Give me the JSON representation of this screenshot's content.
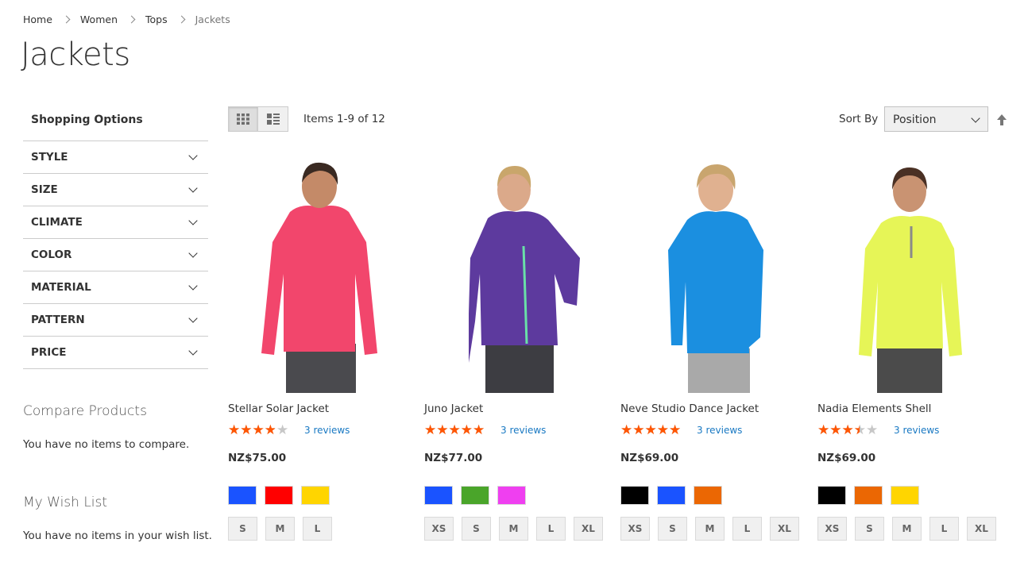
{
  "breadcrumb": [
    "Home",
    "Women",
    "Tops",
    "Jackets"
  ],
  "page_title": "Jackets",
  "sidebar": {
    "title": "Shopping Options",
    "filters": [
      "STYLE",
      "SIZE",
      "CLIMATE",
      "COLOR",
      "MATERIAL",
      "PATTERN",
      "PRICE"
    ]
  },
  "compare": {
    "title": "Compare Products",
    "text": "You have no items to compare."
  },
  "wishlist": {
    "title": "My Wish List",
    "text": "You have no items in your wish list."
  },
  "toolbar": {
    "modes": [
      "grid-icon",
      "list-icon"
    ],
    "active_mode": "grid",
    "items_count": "Items 1-9 of 12",
    "sort_label": "Sort By",
    "sort_value": "Position"
  },
  "colors": {
    "star": "#ff5501",
    "link": "#1979c3"
  },
  "products": [
    {
      "name": "Stellar Solar Jacket",
      "rating": 0.67,
      "reviews": "3 reviews",
      "price": "NZ$75.00",
      "jacket_color": "#f2466c",
      "pants_color": "#4a4a4e",
      "swatches": [
        "#1a53ff",
        "#ff0000",
        "#ffd500"
      ],
      "sizes": [
        "S",
        "M",
        "L"
      ]
    },
    {
      "name": "Juno Jacket",
      "rating": 0.87,
      "reviews": "3 reviews",
      "price": "NZ$77.00",
      "jacket_color": "#5d3a9e",
      "pants_color": "#3d3d42",
      "swatches": [
        "#1a53ff",
        "#4aa52a",
        "#ef3ff0"
      ],
      "sizes": [
        "XS",
        "S",
        "M",
        "L",
        "XL"
      ]
    },
    {
      "name": "Neve Studio Dance Jacket",
      "rating": 0.87,
      "reviews": "3 reviews",
      "price": "NZ$69.00",
      "jacket_color": "#1b8fe0",
      "pants_color": "#a9a9a9",
      "swatches": [
        "#000000",
        "#1a53ff",
        "#eb6703"
      ],
      "sizes": [
        "XS",
        "S",
        "M",
        "L",
        "XL"
      ]
    },
    {
      "name": "Nadia Elements Shell",
      "rating": 0.6,
      "reviews": "3 reviews",
      "price": "NZ$69.00",
      "jacket_color": "#e6f557",
      "pants_color": "#4b4b4b",
      "swatches": [
        "#000000",
        "#eb6703",
        "#ffd500"
      ],
      "sizes": [
        "XS",
        "S",
        "M",
        "L",
        "XL"
      ]
    }
  ]
}
